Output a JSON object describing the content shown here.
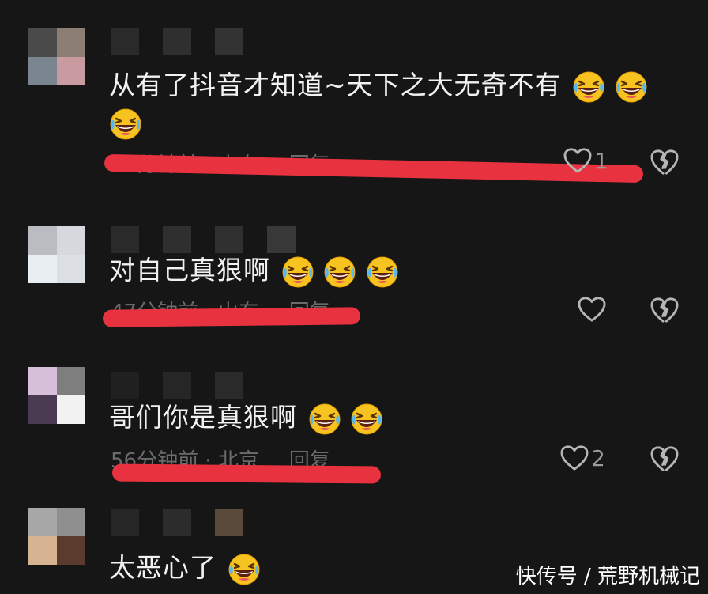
{
  "comments": [
    {
      "text": "从有了抖音才知道~天下之大无奇不有",
      "emoji_count_inline": 2,
      "emoji_count_wrap": 1,
      "time": "57分钟前",
      "location": "山东",
      "reply_label": "回复",
      "likes": "1",
      "avatar_colors": [
        "#4a4a4a",
        "#8c7e73",
        "#7a8590",
        "#c99aa0"
      ]
    },
    {
      "text": "对自己真狠啊",
      "emoji_count_inline": 3,
      "time": "47分钟前",
      "location": "山东",
      "reply_label": "回复",
      "likes": "",
      "avatar_colors": [
        "#b9bcc1",
        "#d7d8de",
        "#e8eef2",
        "#dcdfe3"
      ]
    },
    {
      "text": "哥们你是真狠啊",
      "emoji_count_inline": 2,
      "time": "56分钟前",
      "location": "北京",
      "reply_label": "回复",
      "likes": "2",
      "avatar_colors": [
        "#d5bfd9",
        "#7e7e7e",
        "#4a3a52",
        "#f2f2f2"
      ]
    },
    {
      "text": "太恶心了",
      "emoji_count_inline": 1,
      "avatar_colors": [
        "#a7a7a7",
        "#8f8f8f",
        "#d6b391",
        "#5a3b2e"
      ]
    }
  ],
  "meta_separator": " · ",
  "watermark": "快传号 / 荒野机械记",
  "colors": {
    "background": "#161616",
    "underline": "#e8323f",
    "meta_text": "#6b6b6b"
  },
  "icons": [
    "heart-outline-icon",
    "broken-heart-icon",
    "grinning-squinting-laughing-emoji"
  ]
}
